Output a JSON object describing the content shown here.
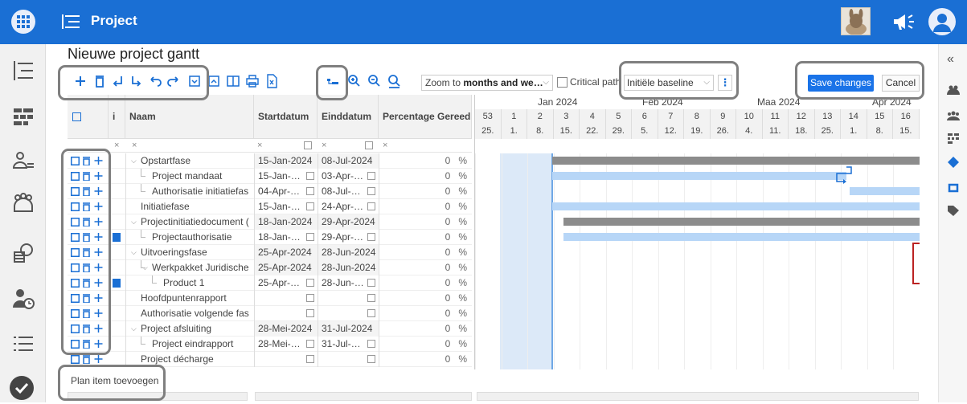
{
  "app": {
    "title": "Project",
    "brand_color": "#1a6fd4"
  },
  "page": {
    "title": "Nieuwe project gantt"
  },
  "toolbar": {
    "zoom_label": "Zoom to ",
    "zoom_value": "months and we…",
    "critical_path_label": "Critical path",
    "baseline_value": "Initiële baseline",
    "save_label": "Save changes",
    "cancel_label": "Cancel",
    "icons": [
      "add-icon",
      "delete-icon",
      "outdent-icon",
      "indent-icon",
      "undo-icon",
      "redo-icon",
      "expand-icon",
      "collapse-icon",
      "columns-icon",
      "print-icon",
      "export-excel-icon",
      "auto-schedule-icon",
      "zoom-in-icon",
      "zoom-out-icon",
      "zoom-fit-icon"
    ]
  },
  "grid": {
    "headers": {
      "i": "i",
      "name": "Naam",
      "start": "Startdatum",
      "end": "Einddatum",
      "percent": "Percentage Gereed"
    },
    "filter": {
      "x": "×"
    },
    "rows": [
      {
        "name": "Opstartfase",
        "start": "15-Jan-2024",
        "end": "08-Jul-2024",
        "pct": "0",
        "level": 0,
        "group": true,
        "marker": false
      },
      {
        "name": "Project mandaat",
        "start": "15-Jan-…",
        "end": "03-Apr-…",
        "pct": "0",
        "level": 1,
        "group": false,
        "marker": false
      },
      {
        "name": "Authorisatie initiatiefas",
        "start": "04-Apr-…",
        "end": "08-Jul-…",
        "pct": "0",
        "level": 1,
        "group": false,
        "marker": false
      },
      {
        "name": "Initiatiefase",
        "start": "15-Jan-…",
        "end": "24-Apr-…",
        "pct": "0",
        "level": 0,
        "group": false,
        "marker": false
      },
      {
        "name": "Projectinitiatiedocument (",
        "start": "18-Jan-2024",
        "end": "29-Apr-2024",
        "pct": "0",
        "level": 0,
        "group": true,
        "marker": false
      },
      {
        "name": "Projectauthorisatie",
        "start": "18-Jan-…",
        "end": "29-Apr-…",
        "pct": "0",
        "level": 1,
        "group": false,
        "marker": true
      },
      {
        "name": "Uitvoeringsfase",
        "start": "25-Apr-2024",
        "end": "28-Jun-2024",
        "pct": "0",
        "level": 0,
        "group": true,
        "marker": false
      },
      {
        "name": "Werkpakket Juridische",
        "start": "25-Apr-2024",
        "end": "28-Jun-2024",
        "pct": "0",
        "level": 1,
        "group": true,
        "marker": false
      },
      {
        "name": "Product 1",
        "start": "25-Apr-…",
        "end": "28-Jun-…",
        "pct": "0",
        "level": 2,
        "group": false,
        "marker": true
      },
      {
        "name": "Hoofdpuntenrapport",
        "start": "",
        "end": "",
        "pct": "0",
        "level": 0,
        "group": false,
        "marker": false
      },
      {
        "name": "Authorisatie volgende fas",
        "start": "",
        "end": "",
        "pct": "0",
        "level": 0,
        "group": false,
        "marker": false
      },
      {
        "name": "Project afsluiting",
        "start": "28-Mei-2024",
        "end": "31-Jul-2024",
        "pct": "0",
        "level": 0,
        "group": true,
        "marker": false
      },
      {
        "name": "Project eindrapport",
        "start": "28-Mei-…",
        "end": "31-Jul-…",
        "pct": "0",
        "level": 1,
        "group": false,
        "marker": false
      },
      {
        "name": "Project décharge",
        "start": "",
        "end": "",
        "pct": "0",
        "level": 0,
        "group": false,
        "marker": false
      }
    ],
    "percent_unit": "%",
    "add_item_label": "Plan item toevoegen"
  },
  "gantt": {
    "months": [
      "Jan 2024",
      "Feb 2024",
      "Maa 2024",
      "Apr 2024"
    ],
    "weeks": [
      "53",
      "1",
      "2",
      "3",
      "4",
      "5",
      "6",
      "7",
      "8",
      "9",
      "10",
      "11",
      "12",
      "13",
      "14",
      "15",
      "16"
    ],
    "days": [
      "25.",
      "1.",
      "8.",
      "15.",
      "22.",
      "29.",
      "5.",
      "12.",
      "19.",
      "26.",
      "4.",
      "11.",
      "18.",
      "25.",
      "1.",
      "8.",
      "15."
    ],
    "bar_colors": {
      "summary": "#8c8c8c",
      "task": "#b7d6f7",
      "today": "#dce9f8"
    }
  }
}
